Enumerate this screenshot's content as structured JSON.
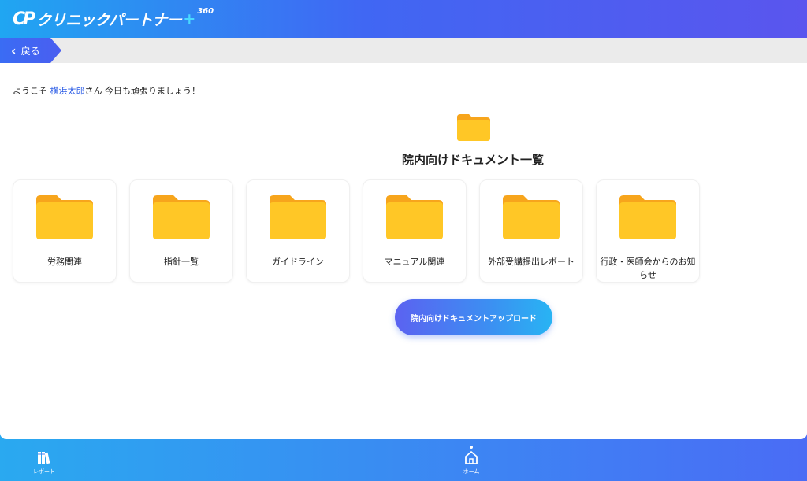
{
  "header": {
    "logo_mark": "CP",
    "logo_text": "クリニックパートナー",
    "logo_plus": "+",
    "logo_sup": "360"
  },
  "subbar": {
    "back_label": "戻る"
  },
  "greeting": {
    "prefix": "ようこそ ",
    "name": "横浜太郎",
    "suffix": "さん 今日も頑張りましょう！"
  },
  "section": {
    "title": "院内向けドキュメント一覧",
    "icon": "folder-icon"
  },
  "folders": [
    {
      "label": "労務関連"
    },
    {
      "label": "指針一覧"
    },
    {
      "label": "ガイドライン"
    },
    {
      "label": "マニュアル関連"
    },
    {
      "label": "外部受講提出レポート"
    },
    {
      "label": "行政・医師会からのお知らせ"
    }
  ],
  "upload_button": {
    "label": "院内向けドキュメントアップロード"
  },
  "footer_nav": {
    "report_label": "レポート",
    "home_label": "ホーム"
  },
  "colors": {
    "accent_blue": "#4a6cf5",
    "accent_cyan": "#28b4f3",
    "folder_yellow": "#ffc726",
    "folder_tab": "#f7a51c",
    "name_link": "#2f5fe6"
  }
}
